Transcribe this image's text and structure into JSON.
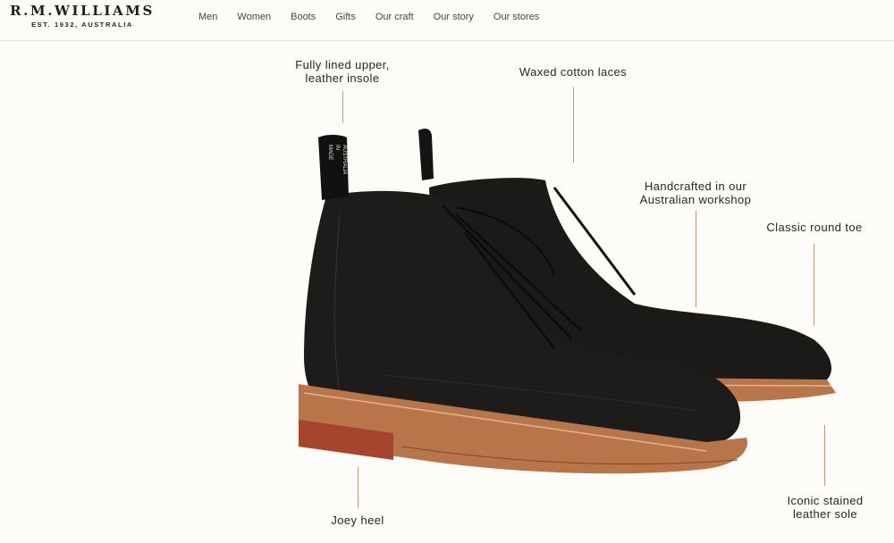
{
  "brand": {
    "name": "R.M.WILLIAMS",
    "tagline": "EST. 1932, AUSTRALIA"
  },
  "nav": {
    "items": [
      "Men",
      "Women",
      "Boots",
      "Gifts",
      "Our craft",
      "Our story",
      "Our stores"
    ]
  },
  "callouts": {
    "upper": {
      "line1": "Fully lined upper,",
      "line2": "leather insole"
    },
    "laces": "Waxed cotton laces",
    "workshop": {
      "line1": "Handcrafted in our",
      "line2": "Australian workshop"
    },
    "toe": "Classic round toe",
    "sole": {
      "line1": "Iconic stained",
      "line2": "leather sole"
    },
    "heel": "Joey heel"
  },
  "pull_tab": {
    "line1": "MADE",
    "line2": "IN",
    "line3": "AUSTRALIA"
  },
  "colors": {
    "background": "#fdfcf8",
    "leader_line": "#c9987a",
    "boot_leather": "#1e1c1a",
    "sole": "#b8754a"
  }
}
